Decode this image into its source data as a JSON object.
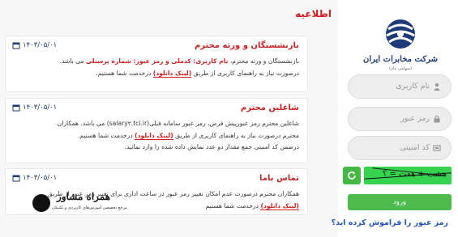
{
  "brand": {
    "name": "شرکت مخابرات ایران",
    "sub": "(سهامی عام)",
    "color": "#1e3a78"
  },
  "login": {
    "username_placeholder": "نام کاربری",
    "password_placeholder": "رمز عبور",
    "captcha_placeholder": "کد امنیتی",
    "captcha_text": "هشت + هفت = ؟",
    "submit_label": "ورود",
    "forgot_label": "رمز عبور را فراموش کرده اید؟",
    "accent": "#4cbb4c"
  },
  "news": {
    "title": "اطلاعیه",
    "items": [
      {
        "heading": "بازنشستگان و ورثه محترم",
        "date": "۱۴۰۳/۰۵/۰۱",
        "line1_a": "بازنشستگان و ورثه محترم، ",
        "line1_b": "نام کاربری: کدملی و رمز عبور: شماره پرسنلی",
        "line1_c": " می باشد.",
        "line2_a": "درصورت نیاز به راهنمای کاربری از طریق ",
        "link": "(لینک دانلود)",
        "line2_b": " درخدمت شما هستیم."
      },
      {
        "heading": "شاغلین محترم",
        "date": "۱۴۰۳/۰۵/۰۱",
        "line1": "شاغلین محترم رمز عبورپیش فرض، رمز عبور سامانه قبلی(salary۲.tci.ir) می باشد. همکاران",
        "line2_a": "محترم درصورت نیاز به راهنمای کاربری از طریق ",
        "link": "(لینک دانلود)",
        "line2_b": " درخدمت شما هستیم.",
        "line3": "درضمن کد امنیتی جمع مقدار دو عدد نمایش داده شده را وارد نمائید."
      },
      {
        "heading": "تماس باما",
        "date": "۱۴۰۳/۰۵/۰۱",
        "line1": "همکاران محترم درصورت عدم امکان تغییر رمز عبور در ساعت اداری برای تغییر رمز عبور از طریق",
        "link": "(لینک دانلود)",
        "line2_b": " درخدمت شما هستیم"
      }
    ]
  },
  "watermark": {
    "title": "همراه مشاور",
    "sub": "مرجع تخصصی آموزش‌های کاربردی و تکنیکی"
  }
}
